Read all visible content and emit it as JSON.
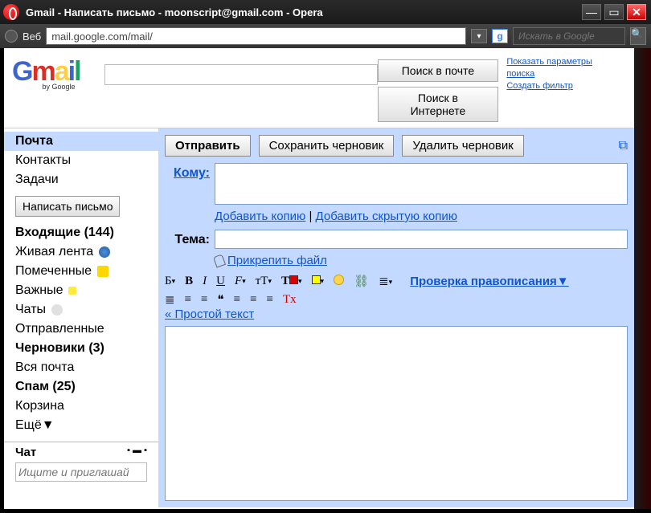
{
  "window": {
    "title": "Gmail - Написать письмо - moonscript@gmail.com - Opera"
  },
  "addressbar": {
    "web_label": "Веб",
    "url": "mail.google.com/mail/",
    "search_placeholder": "Искать в Google"
  },
  "header": {
    "search_mail_btn": "Поиск в почте",
    "search_web_btn": "Поиск в Интернете",
    "links": {
      "show_options": "Показать параметры поиска",
      "create_filter": "Создать фильтр"
    }
  },
  "sidebar": {
    "top": [
      {
        "label": "Почта",
        "selected": true
      },
      {
        "label": "Контакты",
        "selected": false
      },
      {
        "label": "Задачи",
        "selected": false
      }
    ],
    "compose_btn": "Написать письмо",
    "folders": [
      {
        "label": "Входящие (144)",
        "bold": true,
        "icon": ""
      },
      {
        "label": "Живая лента",
        "bold": false,
        "icon": "buzz"
      },
      {
        "label": "Помеченные",
        "bold": false,
        "icon": "star"
      },
      {
        "label": "Важные",
        "bold": false,
        "icon": "imp"
      },
      {
        "label": "Чаты",
        "bold": false,
        "icon": "chat"
      },
      {
        "label": "Отправленные",
        "bold": false,
        "icon": ""
      },
      {
        "label": "Черновики (3)",
        "bold": true,
        "icon": ""
      },
      {
        "label": "Вся почта",
        "bold": false,
        "icon": ""
      },
      {
        "label": "Спам (25)",
        "bold": true,
        "icon": ""
      },
      {
        "label": "Корзина",
        "bold": false,
        "icon": ""
      },
      {
        "label": "Ещё▼",
        "bold": false,
        "icon": ""
      }
    ],
    "chat": {
      "heading": "Чат",
      "search_placeholder": "Ищите и приглашай"
    }
  },
  "compose": {
    "send_btn": "Отправить",
    "save_btn": "Сохранить черновик",
    "discard_btn": "Удалить черновик",
    "to_label": "Кому:",
    "add_cc": "Добавить копию",
    "sep": " | ",
    "add_bcc": "Добавить скрытую копию",
    "subject_label": "Тема:",
    "attach": "Прикрепить файл",
    "spellcheck": "Проверка правописания",
    "plain_text": "« Простой текст",
    "toolbar": {
      "font": "Б",
      "bold": "В",
      "italic": "I",
      "underline": "U",
      "fontfam": "F",
      "fontsize": "тТ",
      "remove": "Tx",
      "bullets": "≣",
      "numbers": "≣",
      "outdent": "≡",
      "indent": "≡",
      "quote": "❝",
      "left": "≡",
      "center": "≡",
      "right": "≡"
    }
  }
}
